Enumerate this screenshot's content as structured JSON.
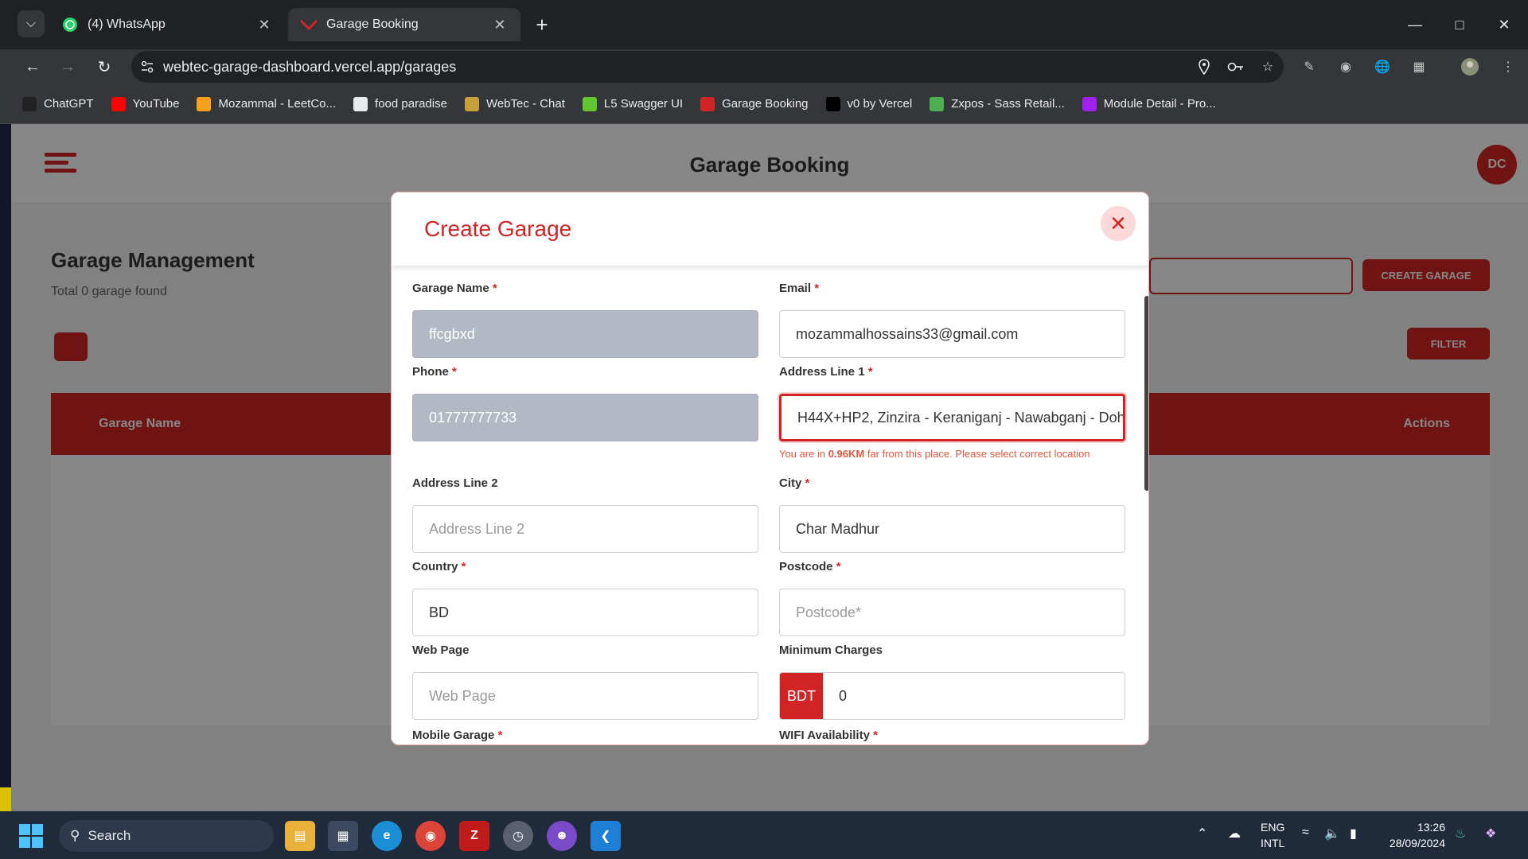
{
  "browser": {
    "tabs": [
      {
        "label": "(4) WhatsApp",
        "icon": "whatsapp-icon",
        "color": "#25d366"
      },
      {
        "label": "Garage Booking",
        "icon": "garage-logo-icon",
        "color": "#d12525"
      }
    ],
    "url": "webtec-garage-dashboard.vercel.app/garages",
    "bookmarks": [
      {
        "label": "ChatGPT",
        "icon": "chatgpt-icon",
        "color": "#222222"
      },
      {
        "label": "YouTube",
        "icon": "youtube-icon",
        "color": "#ff0000"
      },
      {
        "label": "Mozammal - LeetCo...",
        "icon": "leetcode-icon",
        "color": "#f89f1b"
      },
      {
        "label": "food paradise",
        "icon": "github-icon",
        "color": "#e8eaed"
      },
      {
        "label": "WebTec - Chat",
        "icon": "webtec-icon",
        "color": "#c7a03a"
      },
      {
        "label": "L5 Swagger UI",
        "icon": "swagger-icon",
        "color": "#62c62e"
      },
      {
        "label": "Garage Booking",
        "icon": "garage-logo-icon",
        "color": "#d12525"
      },
      {
        "label": "v0 by Vercel",
        "icon": "v0-icon",
        "color": "#000000"
      },
      {
        "label": "Zxpos - Sass Retail...",
        "icon": "zxpos-icon",
        "color": "#4caf50"
      },
      {
        "label": "Module Detail - Pro...",
        "icon": "module-icon",
        "color": "#a020f0"
      }
    ]
  },
  "app": {
    "title": "Garage Booking",
    "avatar": "DC",
    "page_title": "Garage Management",
    "page_subtitle": "Total 0 garage found",
    "create_button": "CREATE GARAGE",
    "filter_button": "FILTER",
    "table_headers": [
      "Garage Name",
      "Actions"
    ]
  },
  "modal": {
    "title": "Create Garage",
    "fields": {
      "garage_name": {
        "label": "Garage Name",
        "value": "ffcgbxd"
      },
      "email": {
        "label": "Email",
        "value": "mozammalhossains33@gmail.com"
      },
      "phone": {
        "label": "Phone",
        "value": "01777777733"
      },
      "address1": {
        "label": "Address Line 1",
        "value": "H44X+HP2, Zinzira - Keraniganj - Nawabganj - Doh",
        "hint_pre": "You are in ",
        "hint_bold": "0.96KM",
        "hint_post": " far from this place. Please select correct location"
      },
      "address2": {
        "label": "Address Line 2",
        "placeholder": "Address Line 2"
      },
      "city": {
        "label": "City",
        "value": "Char Madhur"
      },
      "country": {
        "label": "Country",
        "value": "BD"
      },
      "postcode": {
        "label": "Postcode",
        "placeholder": "Postcode*"
      },
      "webpage": {
        "label": "Web Page",
        "placeholder": "Web Page"
      },
      "min_charges": {
        "label": "Minimum Charges",
        "currency": "BDT",
        "value": "0"
      },
      "mobile_garage": {
        "label": "Mobile Garage"
      },
      "wifi": {
        "label": "WIFI Availability"
      }
    },
    "required_mark": "*"
  },
  "taskbar": {
    "search": "Search",
    "lang": "ENG",
    "layout": "INTL",
    "time": "13:26",
    "date": "28/09/2024"
  }
}
